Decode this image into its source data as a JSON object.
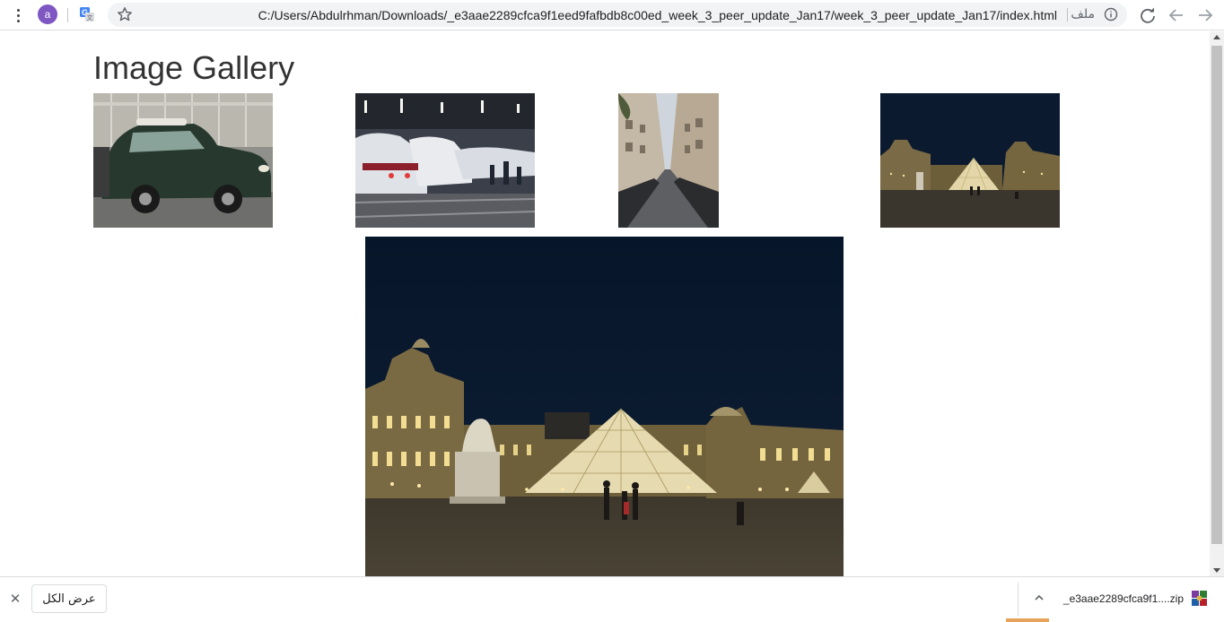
{
  "browser": {
    "avatar_letter": "a",
    "url": "C:/Users/Abdulrhman/Downloads/_e3aae2289cfca9f1eed9fafbdb8c00ed_week_3_peer_update_Jan17/week_3_peer_update_Jan17/index.html",
    "file_label": "ملف",
    "icons": [
      "menu-icon",
      "translate-icon",
      "star-icon",
      "info-icon",
      "reload-icon",
      "back-icon",
      "forward-icon"
    ]
  },
  "page": {
    "title": "Image Gallery",
    "thumbnails": [
      {
        "subject": "green mini car parked on street"
      },
      {
        "subject": "TGV trains at station platform"
      },
      {
        "subject": "narrow Paris street with parked cars"
      },
      {
        "subject": "Louvre pyramid at night"
      }
    ],
    "main_image": {
      "subject": "Louvre pyramid at night"
    }
  },
  "download_shelf": {
    "show_all_label": "عرض الكل",
    "file_name": "_e3aae2289cfca9f1....zip"
  },
  "colors": {
    "avatar": "#7e57c2",
    "night_sky": "#0b1a2e",
    "progress": "#e8a35a"
  }
}
